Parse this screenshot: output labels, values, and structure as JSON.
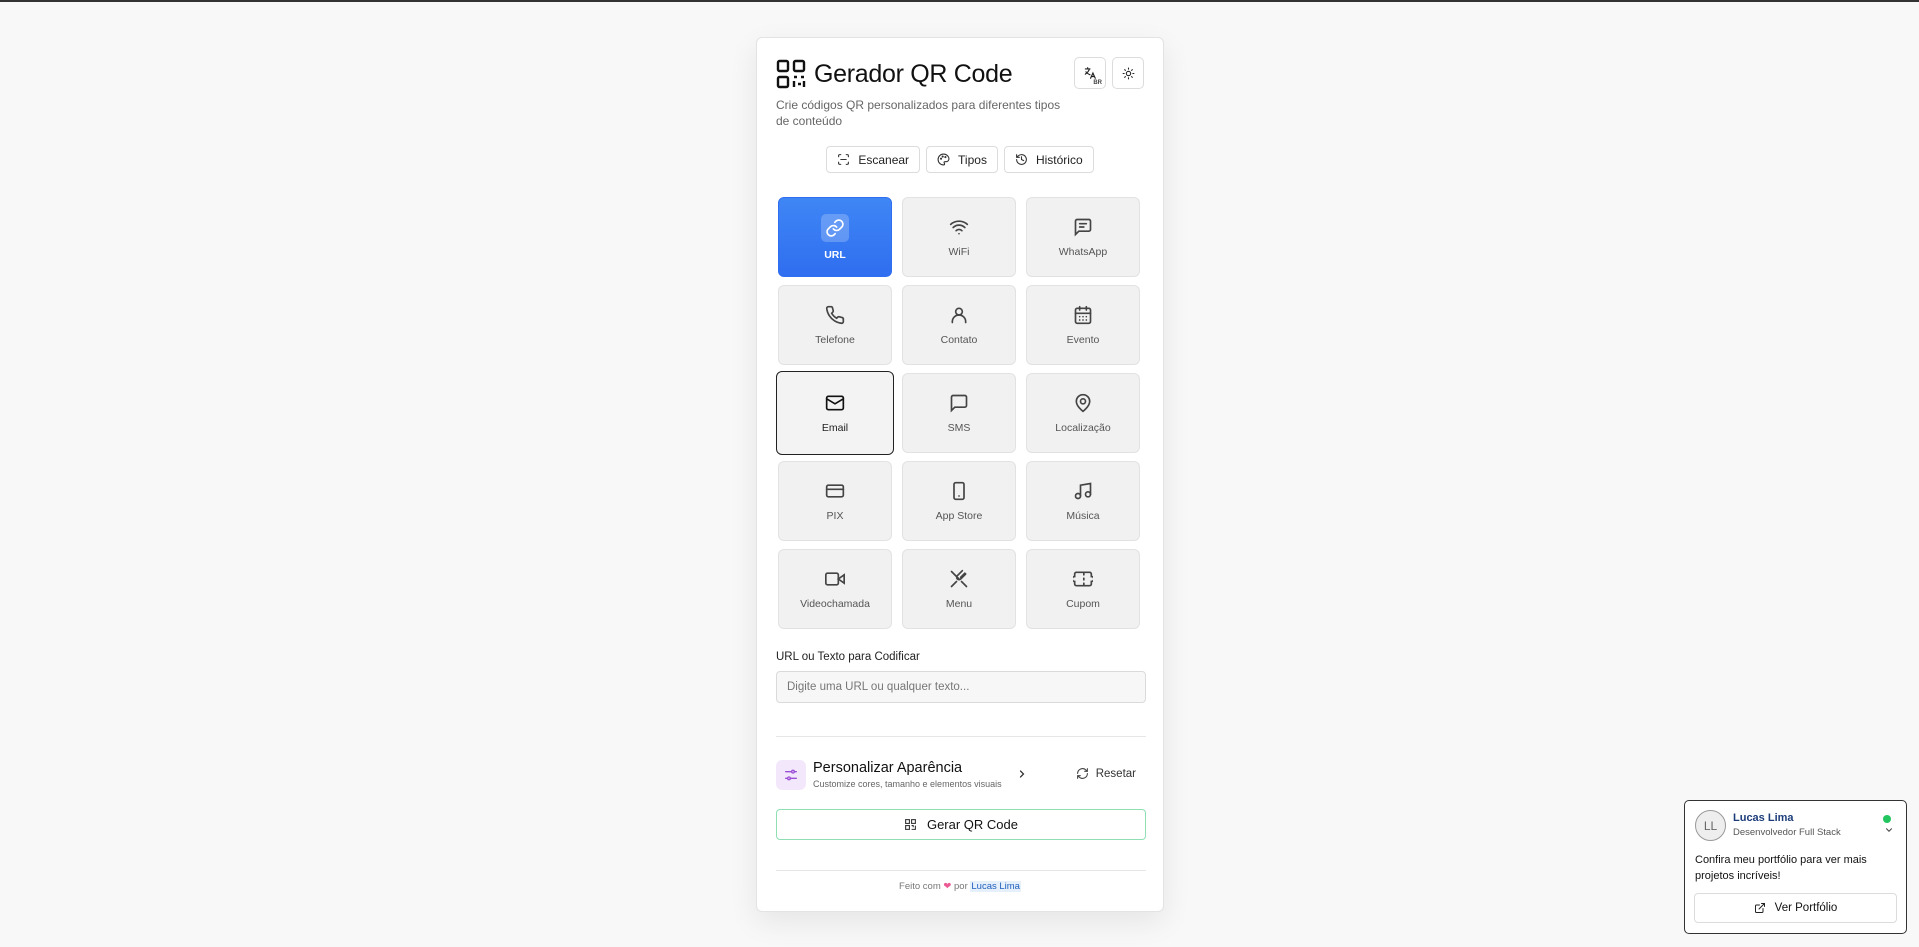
{
  "app": {
    "title": "Gerador QR Code",
    "subtitle": "Crie códigos QR personalizados para diferentes tipos de conteúdo",
    "language_badge": "BR"
  },
  "tabs": [
    {
      "label": "Escanear",
      "icon": "scan-icon"
    },
    {
      "label": "Tipos",
      "icon": "palette-icon"
    },
    {
      "label": "Histórico",
      "icon": "history-icon"
    }
  ],
  "types": [
    {
      "label": "URL",
      "icon": "link-icon",
      "state": "selected"
    },
    {
      "label": "WiFi",
      "icon": "wifi-icon"
    },
    {
      "label": "WhatsApp",
      "icon": "message-square-icon"
    },
    {
      "label": "Telefone",
      "icon": "phone-icon"
    },
    {
      "label": "Contato",
      "icon": "user-icon"
    },
    {
      "label": "Evento",
      "icon": "calendar-icon"
    },
    {
      "label": "Email",
      "icon": "mail-icon",
      "state": "focused"
    },
    {
      "label": "SMS",
      "icon": "message-circle-icon"
    },
    {
      "label": "Localização",
      "icon": "map-pin-icon"
    },
    {
      "label": "PIX",
      "icon": "credit-card-icon"
    },
    {
      "label": "App Store",
      "icon": "smartphone-icon"
    },
    {
      "label": "Música",
      "icon": "music-icon"
    },
    {
      "label": "Videochamada",
      "icon": "video-icon"
    },
    {
      "label": "Menu",
      "icon": "utensils-icon"
    },
    {
      "label": "Cupom",
      "icon": "ticket-icon"
    }
  ],
  "input": {
    "label": "URL ou Texto para Codificar",
    "placeholder": "Digite uma URL ou qualquer texto...",
    "value": ""
  },
  "customize": {
    "title": "Personalizar Aparência",
    "subtitle": "Customize cores, tamanho e elementos visuais",
    "reset_label": "Resetar"
  },
  "generate_label": "Gerar QR Code",
  "footer": {
    "prefix": "Feito com",
    "by": "por",
    "author": "Lucas Lima"
  },
  "profile": {
    "initials": "LL",
    "name": "Lucas Lima",
    "role": "Desenvolvedor Full Stack",
    "message": "Confira meu portfólio para ver mais projetos incríveis!",
    "button_label": "Ver Portfólio",
    "status": "online"
  },
  "colors": {
    "accent": "#3b82f6",
    "generate_border": "#8ee0b3",
    "online": "#22c55e",
    "customize_bg": "#f3e8fb"
  }
}
